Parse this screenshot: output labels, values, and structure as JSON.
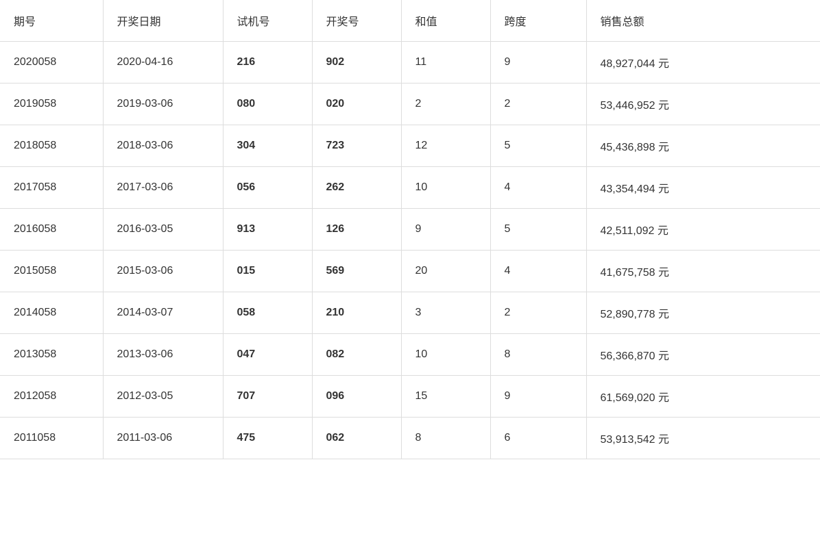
{
  "table": {
    "headers": [
      "期号",
      "开奖日期",
      "试机号",
      "开奖号",
      "和值",
      "跨度",
      "销售总额"
    ],
    "rows": [
      {
        "qihao": "2020058",
        "kaijangriqi": "2020-04-16",
        "shijihao": "216",
        "kaijianghao": "902",
        "hezhi": "11",
        "kuadu": "9",
        "xiaoshouzonge": "48,927,044 元"
      },
      {
        "qihao": "2019058",
        "kaijangriqi": "2019-03-06",
        "shijihao": "080",
        "kaijianghao": "020",
        "hezhi": "2",
        "kuadu": "2",
        "xiaoshouzonge": "53,446,952 元"
      },
      {
        "qihao": "2018058",
        "kaijangriqi": "2018-03-06",
        "shijihao": "304",
        "kaijianghao": "723",
        "hezhi": "12",
        "kuadu": "5",
        "xiaoshouzonge": "45,436,898 元"
      },
      {
        "qihao": "2017058",
        "kaijangriqi": "2017-03-06",
        "shijihao": "056",
        "kaijianghao": "262",
        "hezhi": "10",
        "kuadu": "4",
        "xiaoshouzonge": "43,354,494 元"
      },
      {
        "qihao": "2016058",
        "kaijangriqi": "2016-03-05",
        "shijihao": "913",
        "kaijianghao": "126",
        "hezhi": "9",
        "kuadu": "5",
        "xiaoshouzonge": "42,511,092 元"
      },
      {
        "qihao": "2015058",
        "kaijangriqi": "2015-03-06",
        "shijihao": "015",
        "kaijianghao": "569",
        "hezhi": "20",
        "kuadu": "4",
        "xiaoshouzonge": "41,675,758 元"
      },
      {
        "qihao": "2014058",
        "kaijangriqi": "2014-03-07",
        "shijihao": "058",
        "kaijianghao": "210",
        "hezhi": "3",
        "kuadu": "2",
        "xiaoshouzonge": "52,890,778 元"
      },
      {
        "qihao": "2013058",
        "kaijangriqi": "2013-03-06",
        "shijihao": "047",
        "kaijianghao": "082",
        "hezhi": "10",
        "kuadu": "8",
        "xiaoshouzonge": "56,366,870 元"
      },
      {
        "qihao": "2012058",
        "kaijangriqi": "2012-03-05",
        "shijihao": "707",
        "kaijianghao": "096",
        "hezhi": "15",
        "kuadu": "9",
        "xiaoshouzonge": "61,569,020 元"
      },
      {
        "qihao": "2011058",
        "kaijangriqi": "2011-03-06",
        "shijihao": "475",
        "kaijianghao": "062",
        "hezhi": "8",
        "kuadu": "6",
        "xiaoshouzonge": "53,913,542 元"
      }
    ]
  }
}
